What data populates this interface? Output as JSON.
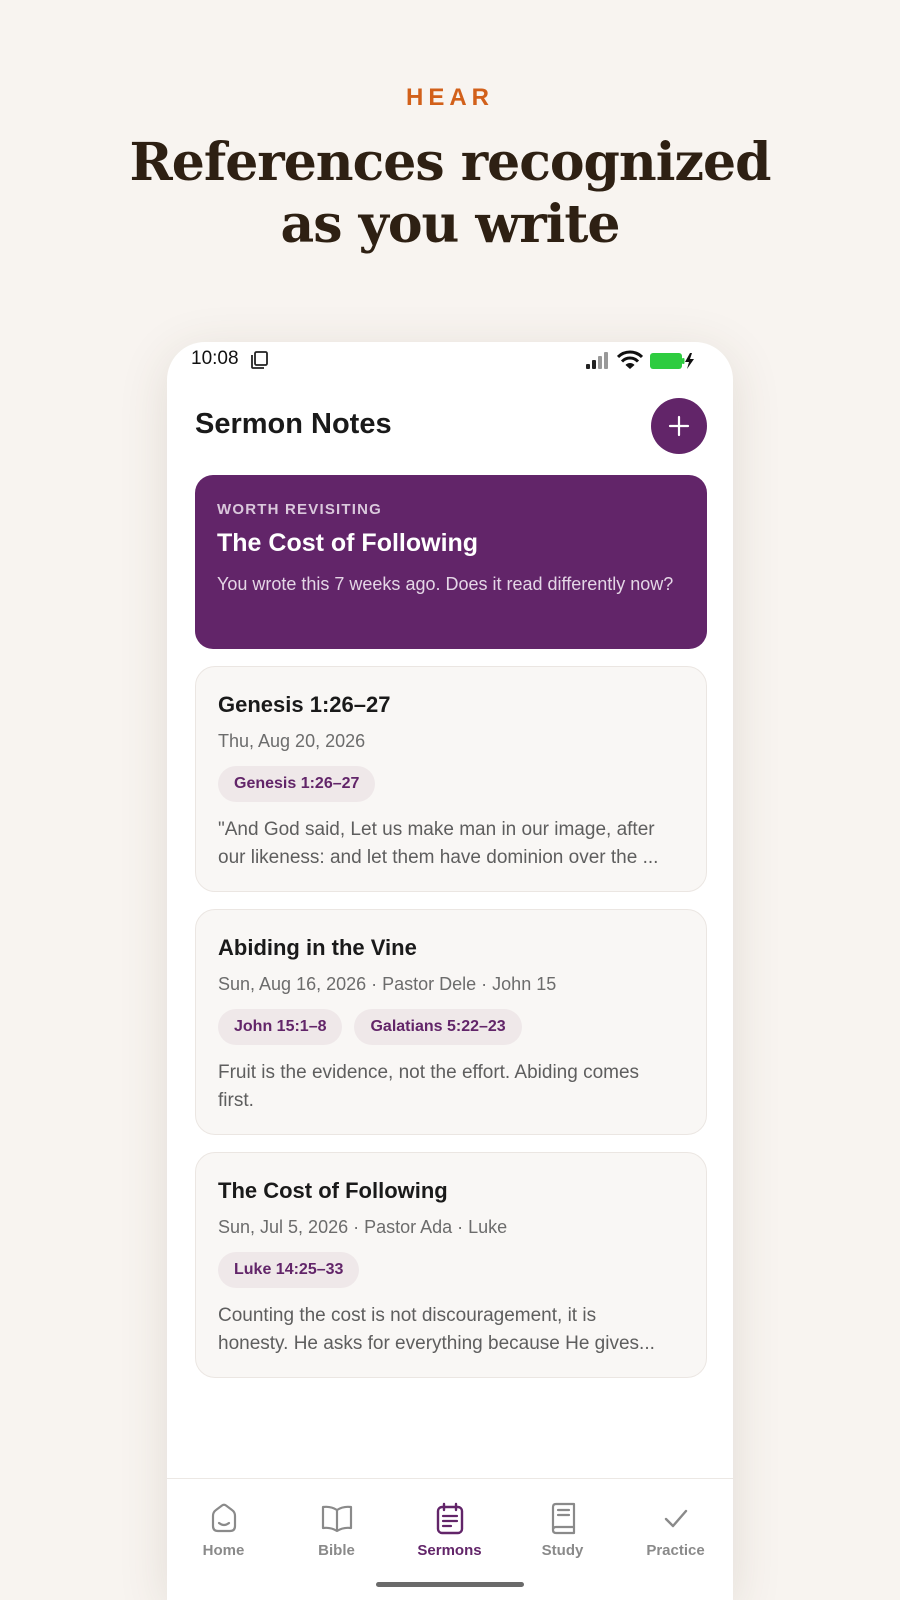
{
  "hero": {
    "eyebrow": "HEAR",
    "headline_line1": "References recognized",
    "headline_line2": "as you write"
  },
  "status_bar": {
    "time": "10:08",
    "icons": [
      "sim-card-icon",
      "signal-icon",
      "wifi-icon",
      "battery-charging-icon"
    ],
    "battery_color": "#2ecc40"
  },
  "header": {
    "title": "Sermon Notes",
    "add_button_icon": "plus-icon"
  },
  "feature_card": {
    "eyebrow": "WORTH REVISITING",
    "title": "The Cost of Following",
    "body": "You wrote this 7 weeks ago. Does it read differently now?"
  },
  "notes": [
    {
      "title": "Genesis 1:26–27",
      "meta": "Thu, Aug 20, 2026",
      "references": [
        "Genesis 1:26–27"
      ],
      "excerpt_line1": "\"And God said, Let us make man in our image, after",
      "excerpt_line2": "our likeness: and let them have dominion over the ..."
    },
    {
      "title": "Abiding in the Vine",
      "meta": "Sun, Aug 16, 2026 · Pastor Dele · John 15",
      "references": [
        "John 15:1–8",
        "Galatians 5:22–23"
      ],
      "excerpt_line1": "Fruit is the evidence, not the effort. Abiding comes",
      "excerpt_line2": "first."
    },
    {
      "title": "The Cost of Following",
      "meta": "Sun, Jul 5, 2026 · Pastor Ada · Luke",
      "references": [
        "Luke 14:25–33"
      ],
      "excerpt_line1": "Counting the cost is not discouragement, it is",
      "excerpt_line2": "honesty. He asks for everything because He gives..."
    }
  ],
  "tabs": [
    {
      "label": "Home",
      "icon": "home-icon",
      "active": false
    },
    {
      "label": "Bible",
      "icon": "open-book-icon",
      "active": false
    },
    {
      "label": "Sermons",
      "icon": "notepad-icon",
      "active": true
    },
    {
      "label": "Study",
      "icon": "study-book-icon",
      "active": false
    },
    {
      "label": "Practice",
      "icon": "checkmark-icon",
      "active": false
    }
  ],
  "colors": {
    "accent": "#622569",
    "eyebrow": "#d2601a",
    "background": "#f8f4f0",
    "headline": "#2e2013"
  }
}
